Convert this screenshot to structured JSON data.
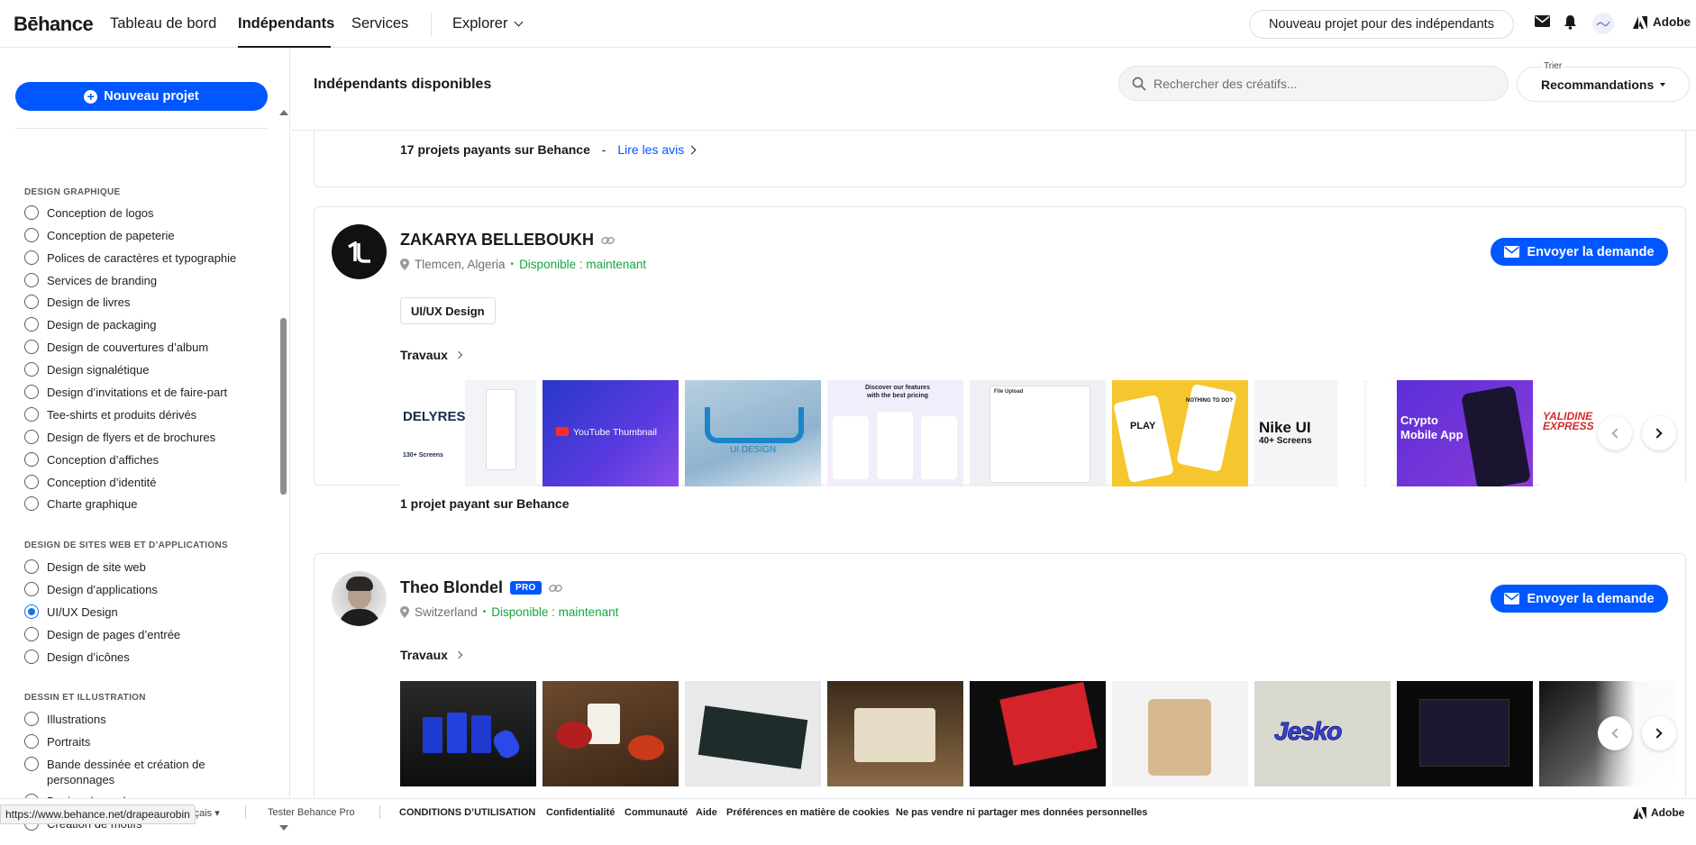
{
  "topnav": {
    "logo": "Bēhance",
    "links": [
      "Tableau de bord",
      "Indépendants",
      "Services"
    ],
    "explorer": "Explorer",
    "new_project_freelance": "Nouveau projet pour des indépendants",
    "adobe": "Adobe"
  },
  "sidebar": {
    "new_project": "Nouveau projet",
    "sections": [
      {
        "title": "DESIGN GRAPHIQUE",
        "items": [
          "Conception de logos",
          "Conception de papeterie",
          "Polices de caractères et typographie",
          "Services de branding",
          "Design de livres",
          "Design de packaging",
          "Design de couvertures d’album",
          "Design signalétique",
          "Design d’invitations et de faire-part",
          "Tee-shirts et produits dérivés",
          "Design de flyers et de brochures",
          "Conception d’affiches",
          "Conception d’identité",
          "Charte graphique"
        ]
      },
      {
        "title": "DESIGN DE SITES WEB ET D’APPLICATIONS",
        "items": [
          "Design de site web",
          "Design d’applications",
          "UI/UX Design",
          "Design de pages d’entrée",
          "Design d’icônes"
        ]
      },
      {
        "title": "DESSIN ET ILLUSTRATION",
        "items": [
          "Illustrations",
          "Portraits",
          "Bande dessinée et création de personnages",
          "Design de mode",
          "Création de motifs"
        ]
      }
    ],
    "selected_item": "UI/UX Design"
  },
  "main": {
    "title": "Indépendants disponibles",
    "search_placeholder": "Rechercher des créatifs...",
    "sort_label": "Trier",
    "sort_value": "Recommandations"
  },
  "cards": [
    {
      "paid_projects": "17 projets payants sur Behance",
      "separator": "-",
      "reviews_link": "Lire les avis"
    },
    {
      "name": "ZAKARYA BELLEBOUKH",
      "location": "Tlemcen, Algeria",
      "availability": "Disponible : maintenant",
      "tag": "UI/UX Design",
      "works_label": "Travaux",
      "send": "Envoyer la demande",
      "paid_projects": "1 projet payant sur Behance",
      "thumb_texts": [
        "DELYRES",
        "130+ Screens",
        "YouTube Thumbnail",
        "UI DESIGN",
        "Discover our features with the best pricing",
        "File Upload",
        "PLAY",
        "NOTHING TO DO?",
        "Nike UI",
        "40+ Screens",
        "Crypto Mobile App",
        "YALIDINE EXPRESS"
      ]
    },
    {
      "name": "Theo Blondel",
      "pro": "PRO",
      "location": "Switzerland",
      "availability": "Disponible : maintenant",
      "works_label": "Travaux",
      "send": "Envoyer la demande",
      "thumb_texts": [
        "Jesko"
      ]
    }
  ],
  "footer": {
    "lang": "Français",
    "pro": "Tester Behance Pro",
    "links": [
      "CONDITIONS D’UTILISATION",
      "Confidentialité",
      "Communauté",
      "Aide",
      "Préférences en matière de cookies",
      "Ne pas vendre ni partager mes données personnelles"
    ],
    "adobe": "Adobe",
    "status_url": "https://www.behance.net/drapeaurobin"
  }
}
